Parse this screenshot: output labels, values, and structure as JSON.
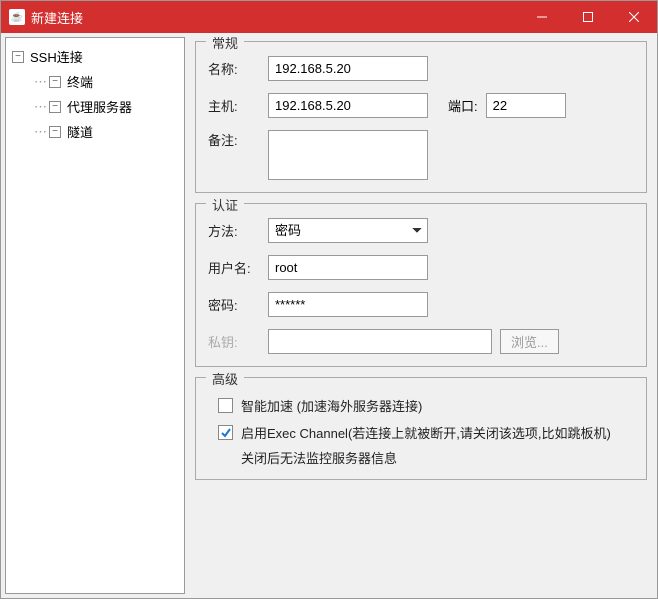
{
  "window": {
    "title": "新建连接",
    "icon_glyph": "☕"
  },
  "sidebar": {
    "items": [
      {
        "label": "SSH连接",
        "expanded": true
      },
      {
        "label": "终端"
      },
      {
        "label": "代理服务器"
      },
      {
        "label": "隧道"
      }
    ]
  },
  "general": {
    "title": "常规",
    "name_label": "名称:",
    "name_value": "192.168.5.20",
    "host_label": "主机:",
    "host_value": "192.168.5.20",
    "port_label": "端口:",
    "port_value": "22",
    "remark_label": "备注:",
    "remark_value": ""
  },
  "auth": {
    "title": "认证",
    "method_label": "方法:",
    "method_value": "密码",
    "user_label": "用户名:",
    "user_value": "root",
    "pass_label": "密码:",
    "pass_value": "******",
    "key_label": "私钥:",
    "key_value": "",
    "browse_label": "浏览..."
  },
  "advanced": {
    "title": "高级",
    "check1_label": "智能加速 (加速海外服务器连接)",
    "check1_checked": false,
    "check2_label": "启用Exec Channel(若连接上就被断开,请关闭该选项,比如跳板机)",
    "check2_sub": "关闭后无法监控服务器信息",
    "check2_checked": true
  }
}
